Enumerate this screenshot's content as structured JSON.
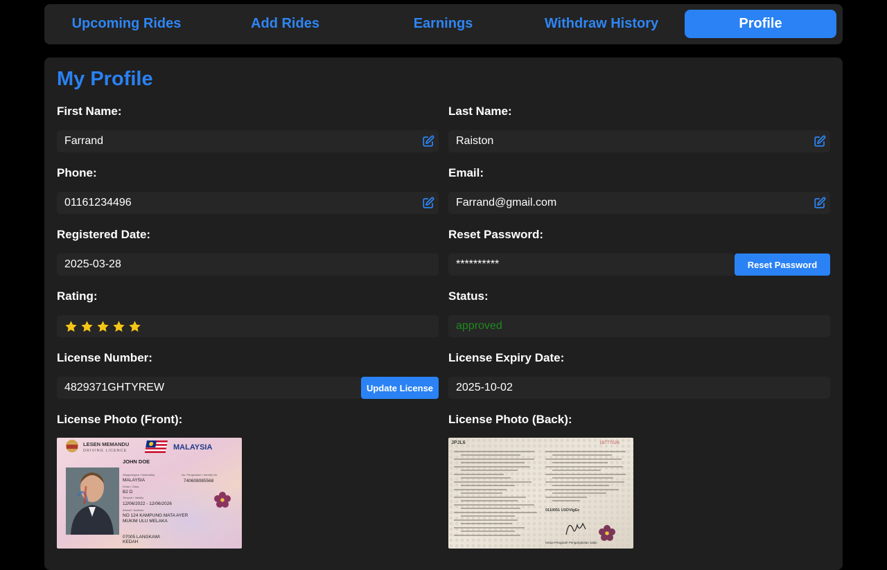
{
  "nav": {
    "tabs": [
      {
        "label": "Upcoming Rides"
      },
      {
        "label": "Add Rides"
      },
      {
        "label": "Earnings"
      },
      {
        "label": "Withdraw History"
      },
      {
        "label": "Profile"
      }
    ],
    "active": "Profile"
  },
  "profile": {
    "title": "My Profile",
    "first_name": {
      "label": "First Name:",
      "value": "Farrand"
    },
    "last_name": {
      "label": "Last Name:",
      "value": "Raiston"
    },
    "phone": {
      "label": "Phone:",
      "value": "01161234496"
    },
    "email": {
      "label": "Email:",
      "value": "Farrand@gmail.com"
    },
    "registered_date": {
      "label": "Registered Date:",
      "value": "2025-03-28"
    },
    "reset_password": {
      "label": "Reset Password:",
      "value": "**********",
      "button": "Reset Password"
    },
    "rating": {
      "label": "Rating:",
      "stars": 5,
      "max": 5
    },
    "status": {
      "label": "Status:",
      "value": "approved"
    },
    "license_number": {
      "label": "License Number:",
      "value": "4829371GHTYREW",
      "button": "Update License"
    },
    "license_expiry": {
      "label": "License Expiry Date:",
      "value": "2025-10-02"
    },
    "license_front": {
      "label": "License Photo (Front):"
    },
    "license_back": {
      "label": "License Photo (Back):"
    }
  },
  "license_front_card": {
    "header1": "LESEN MEMANDU",
    "header2": "DRIVING LICENCE",
    "country": "MALAYSIA",
    "name": "JOHN DOE",
    "nationality_label": "Warganegara / Nationality",
    "nationality": "MALAYSIA",
    "id_label": "No. Pengenalan / Identity No.",
    "id": "740608085568",
    "class_label": "Kelas / Class",
    "class": "B2 D",
    "validity_label": "Tempoh / Validity",
    "validity": "12/06/2022 - 12/06/2026",
    "address_label": "Alamat / Address",
    "address1": "NO 124 KAMPUNG MATA AYER",
    "address2": "MUKIM ULU MELAKA",
    "address3": "07005 LANGKAWI",
    "address4": "KEDAH"
  },
  "license_back_card": {
    "code": "JPJL6",
    "serial": "18777026",
    "ref": "0110051 U3OVIgEe",
    "signature_caption": "Ketua Pengarah Pengangkutan Jalan"
  },
  "colors": {
    "accent": "#2a82f4",
    "panel": "#1f1f1f",
    "field": "#262626",
    "status_approved": "#1f8a1f",
    "star": "#f5c518"
  }
}
